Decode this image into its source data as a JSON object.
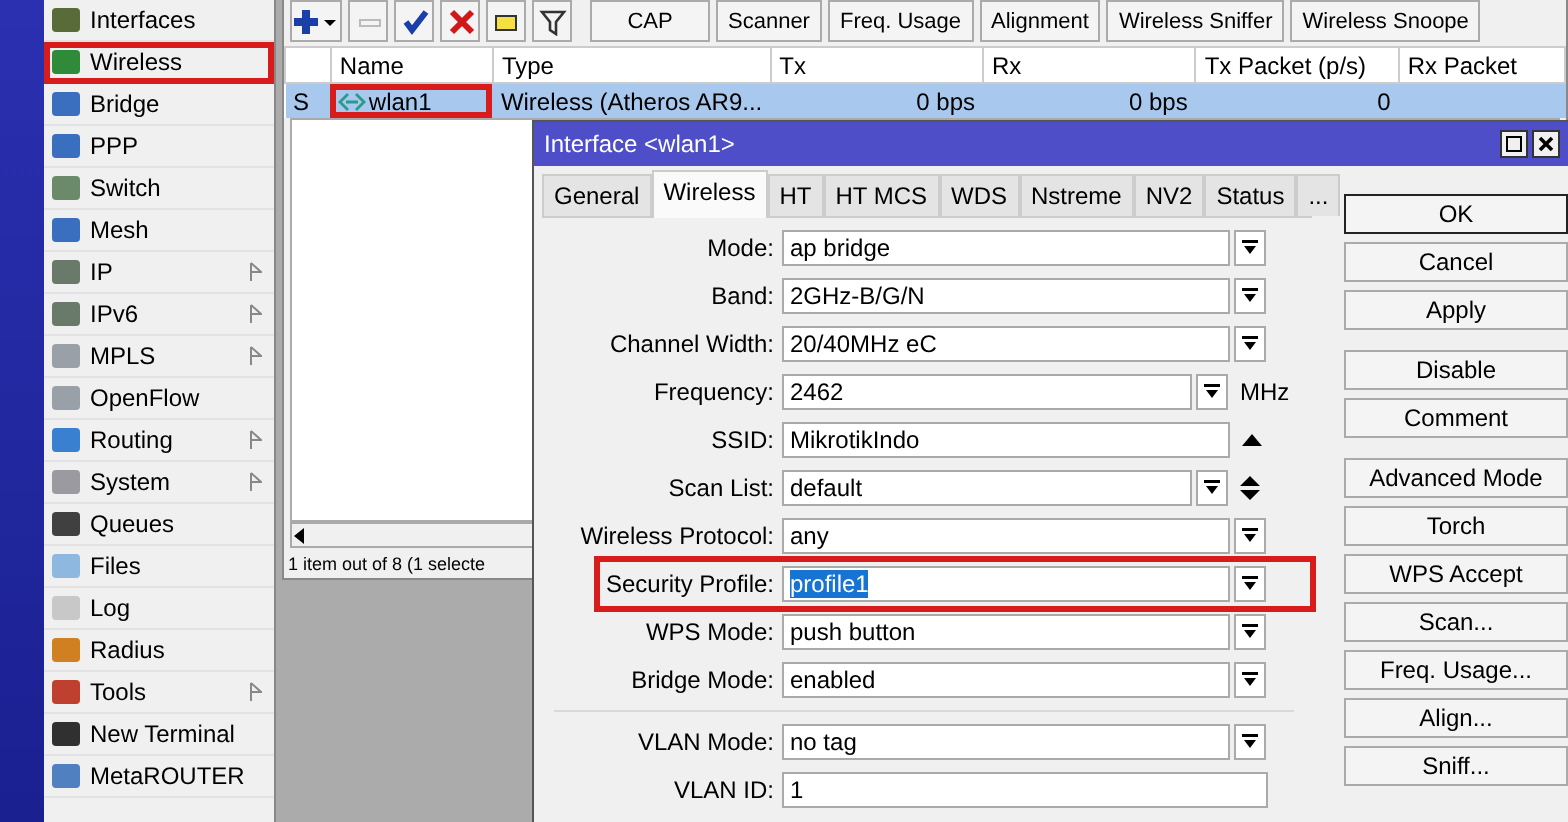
{
  "sidebar": {
    "items": [
      {
        "label": "Interfaces",
        "highlighted": false,
        "submenu": false
      },
      {
        "label": "Wireless",
        "highlighted": true,
        "submenu": false
      },
      {
        "label": "Bridge",
        "highlighted": false,
        "submenu": false
      },
      {
        "label": "PPP",
        "highlighted": false,
        "submenu": false
      },
      {
        "label": "Switch",
        "highlighted": false,
        "submenu": false
      },
      {
        "label": "Mesh",
        "highlighted": false,
        "submenu": false
      },
      {
        "label": "IP",
        "highlighted": false,
        "submenu": true
      },
      {
        "label": "IPv6",
        "highlighted": false,
        "submenu": true
      },
      {
        "label": "MPLS",
        "highlighted": false,
        "submenu": true
      },
      {
        "label": "OpenFlow",
        "highlighted": false,
        "submenu": false
      },
      {
        "label": "Routing",
        "highlighted": false,
        "submenu": true
      },
      {
        "label": "System",
        "highlighted": false,
        "submenu": true
      },
      {
        "label": "Queues",
        "highlighted": false,
        "submenu": false
      },
      {
        "label": "Files",
        "highlighted": false,
        "submenu": false
      },
      {
        "label": "Log",
        "highlighted": false,
        "submenu": false
      },
      {
        "label": "Radius",
        "highlighted": false,
        "submenu": false
      },
      {
        "label": "Tools",
        "highlighted": false,
        "submenu": true
      },
      {
        "label": "New Terminal",
        "highlighted": false,
        "submenu": false
      },
      {
        "label": "MetaROUTER",
        "highlighted": false,
        "submenu": false
      }
    ]
  },
  "list_window": {
    "toolbar": {
      "icon_buttons": [
        {
          "kind": "add",
          "disabled": false
        },
        {
          "kind": "remove",
          "disabled": true
        },
        {
          "kind": "enable",
          "disabled": false
        },
        {
          "kind": "disable",
          "disabled": false
        },
        {
          "kind": "comment",
          "disabled": false
        },
        {
          "kind": "filter",
          "disabled": false
        }
      ],
      "buttons": [
        "CAP",
        "Scanner",
        "Freq. Usage",
        "Alignment",
        "Wireless Sniffer",
        "Wireless Snoope"
      ]
    },
    "table": {
      "columns": [
        "",
        "Name",
        "Type",
        "Tx",
        "Rx",
        "Tx Packet (p/s)",
        "Rx Packet"
      ],
      "rows": [
        {
          "flag": "S",
          "name": "wlan1",
          "type": "Wireless (Atheros AR9...",
          "tx": "0 bps",
          "rx": "0 bps",
          "tx_packet": "0",
          "selected": true,
          "highlighted": true
        }
      ]
    },
    "status": "1 item out of 8 (1 selecte"
  },
  "dialog": {
    "title": "Interface <wlan1>",
    "tabs": [
      {
        "label": "General",
        "selected": false
      },
      {
        "label": "Wireless",
        "selected": true
      },
      {
        "label": "HT",
        "selected": false
      },
      {
        "label": "HT MCS",
        "selected": false
      },
      {
        "label": "WDS",
        "selected": false
      },
      {
        "label": "Nstreme",
        "selected": false
      },
      {
        "label": "NV2",
        "selected": false
      },
      {
        "label": "Status",
        "selected": false
      },
      {
        "label": "...",
        "selected": false
      }
    ],
    "field_groups": [
      [
        {
          "label": "Mode:",
          "value": "ap bridge",
          "kind": "select",
          "selected": false,
          "highlighted": false
        },
        {
          "label": "Band:",
          "value": "2GHz-B/G/N",
          "kind": "select",
          "selected": false,
          "highlighted": false
        },
        {
          "label": "Channel Width:",
          "value": "20/40MHz eC",
          "kind": "select",
          "selected": false,
          "highlighted": false
        },
        {
          "label": "Frequency:",
          "value": "2462",
          "kind": "unitselect",
          "unit": "MHz",
          "selected": false,
          "highlighted": false
        },
        {
          "label": "SSID:",
          "value": "MikrotikIndo",
          "kind": "toggletext",
          "selected": false,
          "highlighted": false
        },
        {
          "label": "Scan List:",
          "value": "default",
          "kind": "multiselect",
          "selected": false,
          "highlighted": false
        },
        {
          "label": "Wireless Protocol:",
          "value": "any",
          "kind": "select",
          "selected": false,
          "highlighted": false
        },
        {
          "label": "Security Profile:",
          "value": "profile1",
          "kind": "select",
          "selected": true,
          "highlighted": true
        },
        {
          "label": "WPS Mode:",
          "value": "push button",
          "kind": "select",
          "selected": false,
          "highlighted": false
        },
        {
          "label": "Bridge Mode:",
          "value": "enabled",
          "kind": "select",
          "selected": false,
          "highlighted": false
        }
      ],
      [
        {
          "label": "VLAN Mode:",
          "value": "no tag",
          "kind": "select",
          "selected": false,
          "highlighted": false
        },
        {
          "label": "VLAN ID:",
          "value": "1",
          "kind": "text",
          "selected": false,
          "highlighted": false
        }
      ]
    ],
    "button_groups": [
      [
        {
          "label": "OK",
          "default": true
        },
        {
          "label": "Cancel",
          "default": false
        },
        {
          "label": "Apply",
          "default": false
        }
      ],
      [
        {
          "label": "Disable",
          "default": false
        },
        {
          "label": "Comment",
          "default": false
        }
      ],
      [
        {
          "label": "Advanced Mode",
          "default": false
        },
        {
          "label": "Torch",
          "default": false
        },
        {
          "label": "WPS Accept",
          "default": false
        },
        {
          "label": "Scan...",
          "default": false
        },
        {
          "label": "Freq. Usage...",
          "default": false
        },
        {
          "label": "Align...",
          "default": false
        },
        {
          "label": "Sniff...",
          "default": false
        }
      ]
    ]
  }
}
